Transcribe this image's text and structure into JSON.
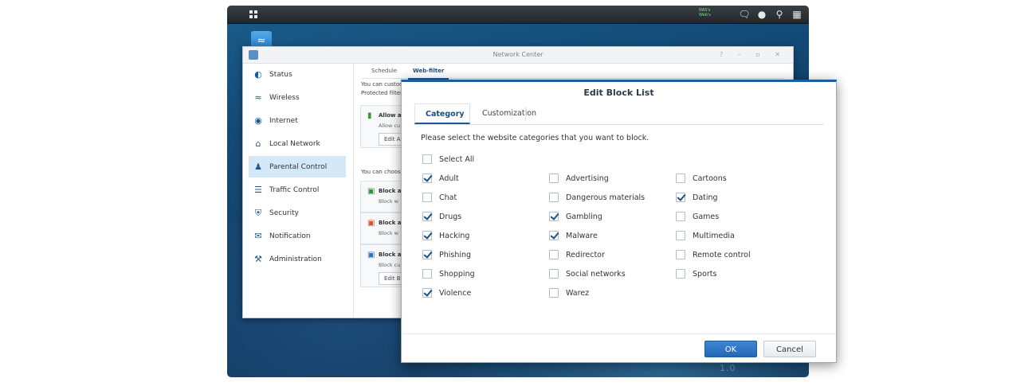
{
  "desktop": {
    "taskbar_status": [
      "NAS's",
      "Web's"
    ],
    "taskbar_icons": [
      "main-menu-icon",
      "chat-icon",
      "user-icon",
      "search-icon",
      "widgets-icon"
    ],
    "watermark": "Synology SRM 1.0"
  },
  "network_center": {
    "title": "Network Center",
    "window_controls": "? – ▫ ✕",
    "nav": [
      {
        "label": "Status",
        "icon": "status-icon"
      },
      {
        "label": "Wireless",
        "icon": "wireless-icon"
      },
      {
        "label": "Internet",
        "icon": "internet-icon"
      },
      {
        "label": "Local Network",
        "icon": "local-network-icon"
      },
      {
        "label": "Parental Control",
        "icon": "parental-control-icon",
        "active": true
      },
      {
        "label": "Traffic Control",
        "icon": "traffic-control-icon"
      },
      {
        "label": "Security",
        "icon": "security-icon"
      },
      {
        "label": "Notification",
        "icon": "notification-icon"
      },
      {
        "label": "Administration",
        "icon": "administration-icon"
      }
    ],
    "tabs": [
      {
        "label": "Schedule"
      },
      {
        "label": "Web-filter",
        "active": true
      }
    ],
    "text1": "You can custom",
    "text2": "Protected filter",
    "text3": "You can choose",
    "cards": [
      {
        "title": "Allow a",
        "desc": "Allow cu",
        "button": "Edit A",
        "color": "#3a9b3a"
      },
      {
        "title": "Block a",
        "desc": "Block w",
        "button": "",
        "color": "#3a8f3a"
      },
      {
        "title": "Block a",
        "desc": "Block w",
        "button": "",
        "color": "#d2572f"
      },
      {
        "title": "Block a",
        "desc": "Block cu",
        "button": "Edit B",
        "color": "#2f6fc4"
      }
    ]
  },
  "dialog": {
    "title": "Edit Block List",
    "tabs": [
      {
        "label": "Category",
        "active": true
      },
      {
        "label": "Customization",
        "active": false
      }
    ],
    "instruction": "Please select the website categories that you want to block.",
    "select_all": {
      "label": "Select All",
      "checked": false
    },
    "columns": [
      [
        {
          "label": "Adult",
          "checked": true
        },
        {
          "label": "Chat",
          "checked": false
        },
        {
          "label": "Drugs",
          "checked": true
        },
        {
          "label": "Hacking",
          "checked": true
        },
        {
          "label": "Phishing",
          "checked": true
        },
        {
          "label": "Shopping",
          "checked": false
        },
        {
          "label": "Violence",
          "checked": true
        }
      ],
      [
        {
          "label": "Advertising",
          "checked": false
        },
        {
          "label": "Dangerous materials",
          "checked": false
        },
        {
          "label": "Gambling",
          "checked": true
        },
        {
          "label": "Malware",
          "checked": true
        },
        {
          "label": "Redirector",
          "checked": false
        },
        {
          "label": "Social networks",
          "checked": false
        },
        {
          "label": "Warez",
          "checked": false
        }
      ],
      [
        {
          "label": "Cartoons",
          "checked": false
        },
        {
          "label": "Dating",
          "checked": true
        },
        {
          "label": "Games",
          "checked": false
        },
        {
          "label": "Multimedia",
          "checked": false
        },
        {
          "label": "Remote control",
          "checked": false
        },
        {
          "label": "Sports",
          "checked": false
        }
      ]
    ],
    "ok_label": "OK",
    "cancel_label": "Cancel"
  },
  "colors": {
    "accent": "#1d5d9b",
    "ok_button": "#2f76c6",
    "selected_nav": "#d5e8f8"
  }
}
